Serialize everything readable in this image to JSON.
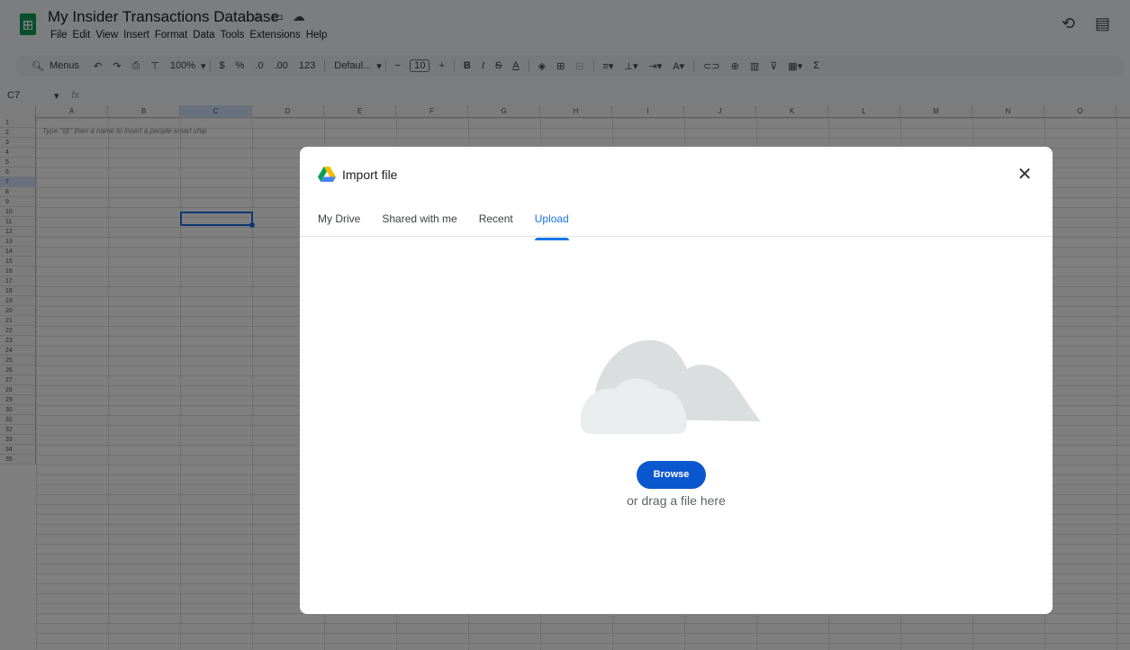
{
  "app": {
    "doc_title": "My Insider Transactions Database",
    "menu": [
      "File",
      "Edit",
      "View",
      "Insert",
      "Format",
      "Data",
      "Tools",
      "Extensions",
      "Help"
    ]
  },
  "toolbar": {
    "search_label": "Menus",
    "zoom": "100%",
    "currency": "$",
    "percent": "%",
    "decrease_decimal": ".0",
    "increase_decimal": ".00",
    "number_format": "123",
    "font_name": "Defaul...",
    "font_size": "10"
  },
  "formula_bar": {
    "cell_ref": "C7",
    "fx": "fx"
  },
  "grid": {
    "columns": [
      "A",
      "B",
      "C",
      "D",
      "E",
      "F",
      "G",
      "H",
      "I",
      "J",
      "K",
      "L",
      "M",
      "N",
      "O"
    ],
    "row_count": 35,
    "selected_column": "C",
    "selected_row": 7,
    "hint": "Type \"@\" then a name to insert a people smart chip"
  },
  "dialog": {
    "title": "Import file",
    "tabs": [
      "My Drive",
      "Shared with me",
      "Recent",
      "Upload"
    ],
    "active_tab": "Upload",
    "browse_label": "Browse",
    "drag_text": "or drag a file here"
  },
  "colors": {
    "accent": "#1a73e8",
    "button": "#0b57d0",
    "sheets_green": "#0f9d58"
  }
}
